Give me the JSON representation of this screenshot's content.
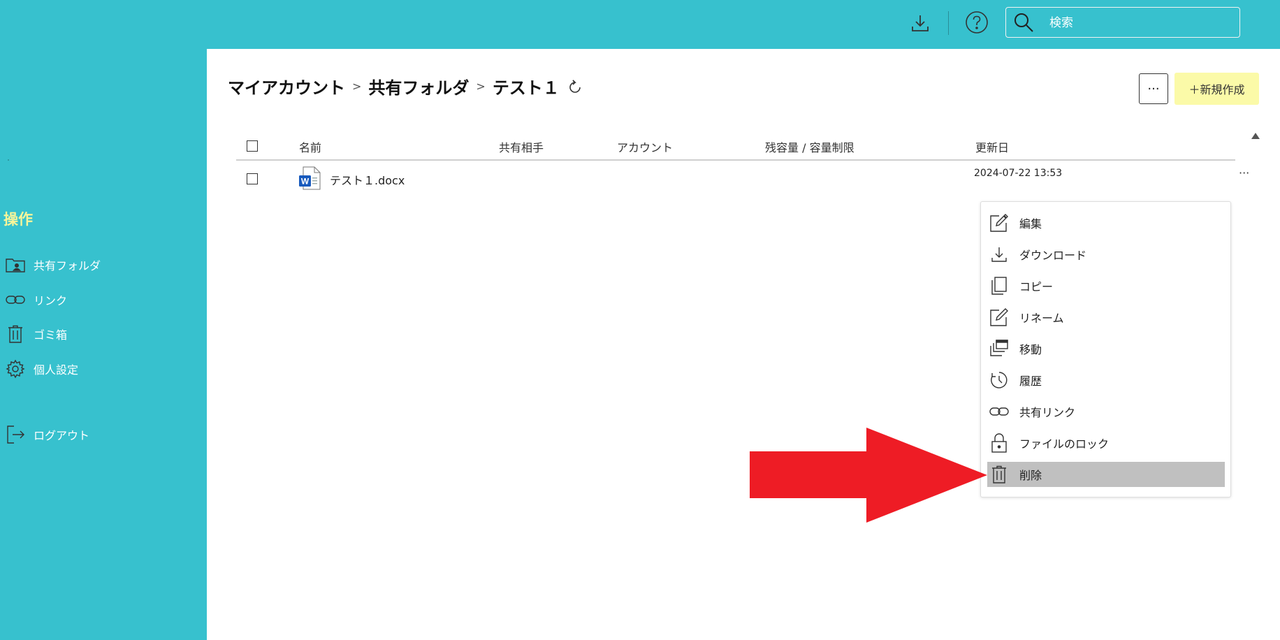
{
  "topbar": {
    "search_placeholder": "検索"
  },
  "sidebar": {
    "heading": "操作",
    "items": [
      {
        "label": "共有フォルダ",
        "icon": "shared-folder-icon"
      },
      {
        "label": "リンク",
        "icon": "link-icon"
      },
      {
        "label": "ゴミ箱",
        "icon": "trash-icon"
      },
      {
        "label": "個人設定",
        "icon": "gear-icon"
      },
      {
        "label": "ログアウト",
        "icon": "logout-icon"
      }
    ]
  },
  "breadcrumb": [
    "マイアカウント",
    "共有フォルダ",
    "テスト１"
  ],
  "toolbar": {
    "more_label": "···",
    "new_label": "＋新規作成"
  },
  "table": {
    "headers": [
      "名前",
      "共有相手",
      "アカウント",
      "残容量 / 容量制限",
      "更新日"
    ],
    "rows": [
      {
        "name": "テスト１.docx",
        "updated": "2024-07-22 13:53",
        "more": "···"
      }
    ]
  },
  "context_menu": {
    "items": [
      {
        "label": "編集",
        "icon": "edit-icon"
      },
      {
        "label": "ダウンロード",
        "icon": "download-icon"
      },
      {
        "label": "コピー",
        "icon": "copy-icon"
      },
      {
        "label": "リネーム",
        "icon": "rename-icon"
      },
      {
        "label": "移動",
        "icon": "move-icon"
      },
      {
        "label": "履歴",
        "icon": "history-icon"
      },
      {
        "label": "共有リンク",
        "icon": "share-link-icon"
      },
      {
        "label": "ファイルのロック",
        "icon": "lock-icon"
      },
      {
        "label": "削除",
        "icon": "trash-icon",
        "selected": true
      }
    ]
  },
  "colors": {
    "accent": "#37c1ce",
    "heading_yellow": "#f7f59a",
    "new_button_bg": "#fbfaa8",
    "selected_item_bg": "#c0c0c0",
    "arrow_red": "#ee1c25",
    "word_blue": "#185abd"
  }
}
